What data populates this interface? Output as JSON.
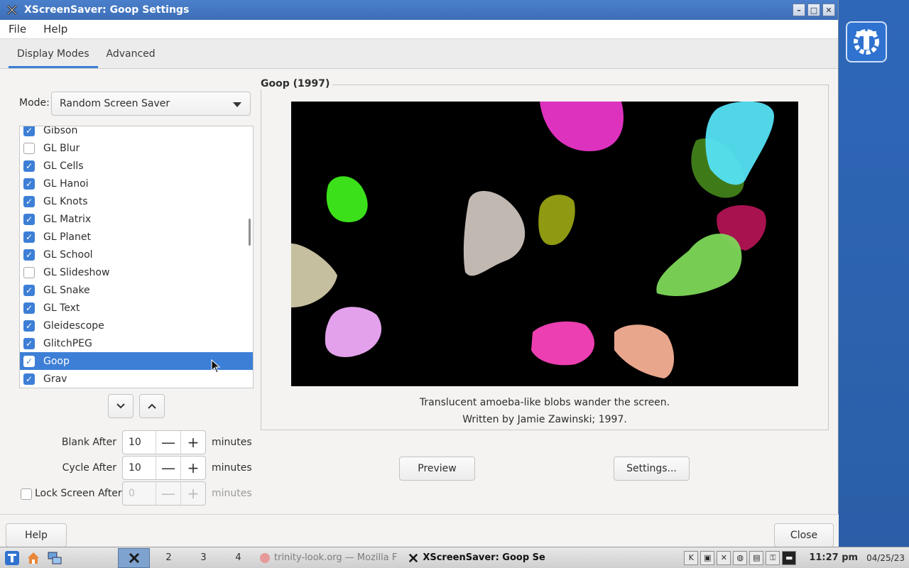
{
  "window": {
    "title": "XScreenSaver: Goop Settings",
    "minimize": "–",
    "maximize": "□",
    "close": "✕"
  },
  "menu": {
    "file": "File",
    "help": "Help"
  },
  "tabs": [
    {
      "label": "Display Modes",
      "active": true
    },
    {
      "label": "Advanced",
      "active": false
    }
  ],
  "mode": {
    "label": "Mode:",
    "value": "Random Screen Saver"
  },
  "hacks": [
    {
      "name": "Gibson",
      "checked": true
    },
    {
      "name": "GL Blur",
      "checked": false
    },
    {
      "name": "GL Cells",
      "checked": true
    },
    {
      "name": "GL Hanoi",
      "checked": true
    },
    {
      "name": "GL Knots",
      "checked": true
    },
    {
      "name": "GL Matrix",
      "checked": true
    },
    {
      "name": "GL Planet",
      "checked": true
    },
    {
      "name": "GL School",
      "checked": true
    },
    {
      "name": "GL Slideshow",
      "checked": false
    },
    {
      "name": "GL Snake",
      "checked": true
    },
    {
      "name": "GL Text",
      "checked": true
    },
    {
      "name": "Gleidescope",
      "checked": true
    },
    {
      "name": "GlitchPEG",
      "checked": true
    },
    {
      "name": "Goop",
      "checked": true,
      "selected": true
    },
    {
      "name": "Grav",
      "checked": true
    }
  ],
  "timing": {
    "blank_label": "Blank After",
    "blank_value": "10",
    "cycle_label": "Cycle After",
    "cycle_value": "10",
    "lock_label": "Lock Screen After",
    "lock_value": "0",
    "unit": "minutes",
    "minus": "—",
    "plus": "+"
  },
  "preview": {
    "heading": "Goop (1997)",
    "description": "Translucent amoeba-like blobs wander the screen.",
    "credit": "Written by Jamie Zawinski; 1997.",
    "preview_button": "Preview",
    "settings_button": "Settings..."
  },
  "footer": {
    "help": "Help",
    "close": "Close"
  },
  "taskbar": {
    "desktops": [
      "2",
      "3",
      "4"
    ],
    "task_browser": "trinity-look.org — Mozilla F",
    "task_current": "XScreenSaver: Goop Se",
    "clock": "11:27 pm",
    "date": "04/25/23"
  }
}
